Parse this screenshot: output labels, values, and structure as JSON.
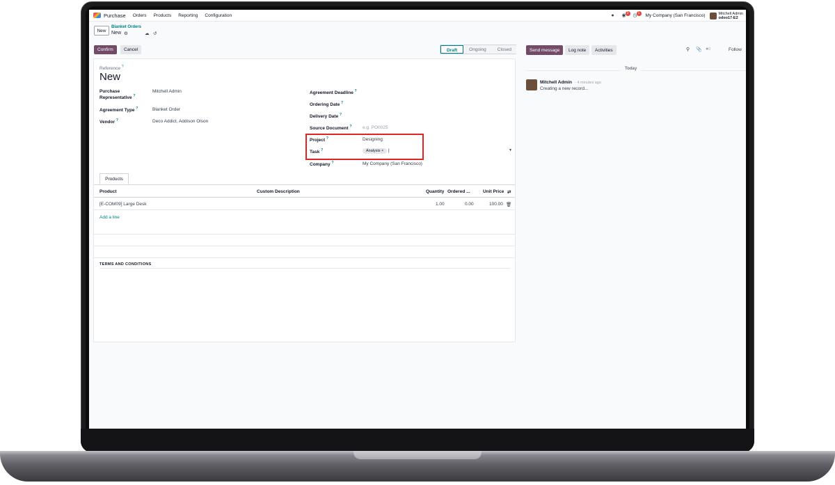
{
  "navbar": {
    "app_name": "Purchase",
    "menu": [
      "Orders",
      "Products",
      "Reporting",
      "Configuration"
    ],
    "messages_count": "3",
    "activities_count": "1",
    "company": "My Company (San Francisco)",
    "user_name": "Mitchell Admin",
    "db_name": "odoo17-E2"
  },
  "control": {
    "new_label": "New",
    "breadcrumb_parent": "Blanket Orders",
    "breadcrumb_current": "New"
  },
  "actions": {
    "confirm_label": "Confirm",
    "cancel_label": "Cancel",
    "statuses": [
      "Draft",
      "Ongoing",
      "Closed"
    ],
    "active_status": "Draft"
  },
  "form": {
    "reference_label": "Reference",
    "title": "New",
    "purchase_rep_label_1": "Purchase",
    "purchase_rep_label_2": "Representative",
    "purchase_rep_value": "Mitchell Admin",
    "agreement_type_label": "Agreement Type",
    "agreement_type_value": "Blanket Order",
    "vendor_label": "Vendor",
    "vendor_value": "Deco Addict, Addison Olson",
    "agreement_deadline_label": "Agreement Deadline",
    "ordering_date_label": "Ordering Date",
    "delivery_date_label": "Delivery Date",
    "source_document_label": "Source Document",
    "source_document_placeholder": "e.g. PO0025",
    "project_label": "Project",
    "project_value": "Designing",
    "task_label": "Task",
    "task_tag": "Analysis",
    "company_label": "Company",
    "company_value": "My Company (San Francisco)"
  },
  "products": {
    "tab_label": "Products",
    "columns": [
      "Product",
      "Custom Description",
      "Quantity",
      "Ordered ...",
      "Unit Price"
    ],
    "rows": [
      {
        "product": "[E-COM09] Large Desk",
        "description": "",
        "quantity": "1.00",
        "ordered": "0.00",
        "unit_price": "100.00"
      }
    ],
    "add_line_label": "Add a line",
    "terms_label": "TERMS AND CONDITIONS"
  },
  "chatter": {
    "send_message_label": "Send message",
    "log_note_label": "Log note",
    "activities_label": "Activities",
    "followers_count": "0",
    "follow_label": "Follow",
    "date_separator": "Today",
    "message_author": "Mitchell Admin",
    "message_time": "- 4 minutes ago",
    "message_body": "Creating a new record..."
  }
}
